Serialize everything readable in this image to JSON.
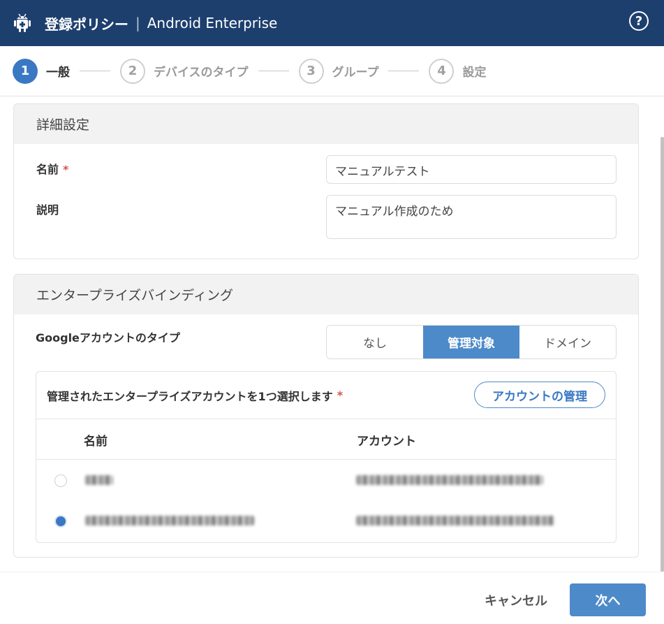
{
  "header": {
    "title": "登録ポリシー",
    "separator": "|",
    "subtitle": "Android Enterprise",
    "help_glyph": "?",
    "icon": "android-icon"
  },
  "stepper": {
    "steps": [
      {
        "num": "1",
        "label": "一般",
        "active": true
      },
      {
        "num": "2",
        "label": "デバイスのタイプ",
        "active": false
      },
      {
        "num": "3",
        "label": "グループ",
        "active": false
      },
      {
        "num": "4",
        "label": "設定",
        "active": false
      }
    ]
  },
  "details": {
    "heading": "詳細設定",
    "name_label": "名前",
    "required_mark": "*",
    "name_value": "マニュアルテスト",
    "description_label": "説明",
    "description_value": "マニュアル作成のため"
  },
  "binding": {
    "heading": "エンタープライズバインディング",
    "account_type_label": "Googleアカウントのタイプ",
    "options": [
      "なし",
      "管理対象",
      "ドメイン"
    ],
    "selected": "管理対象",
    "select_prompt": "管理されたエンタープライズアカウントを1つ選択します",
    "manage_button": "アカウントの管理",
    "table": {
      "columns": [
        "名前",
        "アカウント"
      ]
    }
  },
  "footer": {
    "cancel_label": "キャンセル",
    "next_label": "次へ"
  },
  "colors": {
    "header_bg": "#1d3f6e",
    "accent": "#4d8ac9",
    "required": "#d9534f"
  }
}
